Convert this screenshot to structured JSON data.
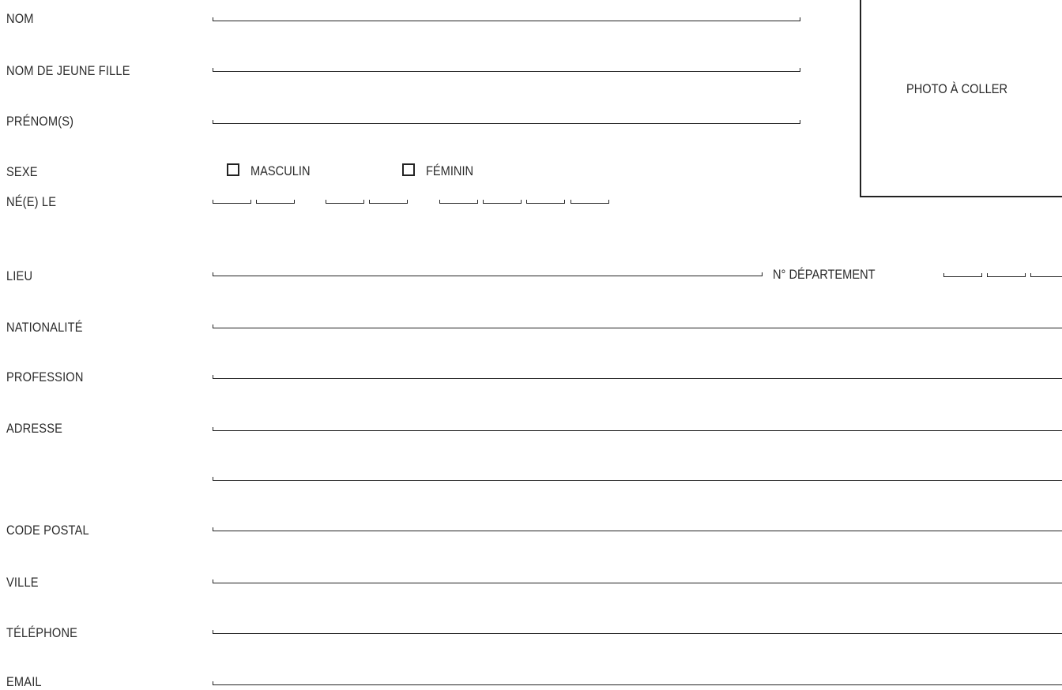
{
  "labels": {
    "nom": "NOM",
    "nom_jeune_fille": "NOM DE JEUNE FILLE",
    "prenoms": "PRÉNOM(S)",
    "sexe": "SEXE",
    "ne_le": "NÉ(E) LE",
    "lieu": "LIEU",
    "nationalite": "NATIONALITÉ",
    "profession": "PROFESSION",
    "adresse": "ADRESSE",
    "code_postal": "CODE POSTAL",
    "ville": "VILLE",
    "telephone": "TÉLÉPHONE",
    "email": "EMAIL"
  },
  "sexe_options": {
    "masculin": "MASCULIN",
    "feminin": "FÉMININ"
  },
  "departement_label": "N° DÉPARTEMENT",
  "photo_label": "PHOTO À COLLER"
}
